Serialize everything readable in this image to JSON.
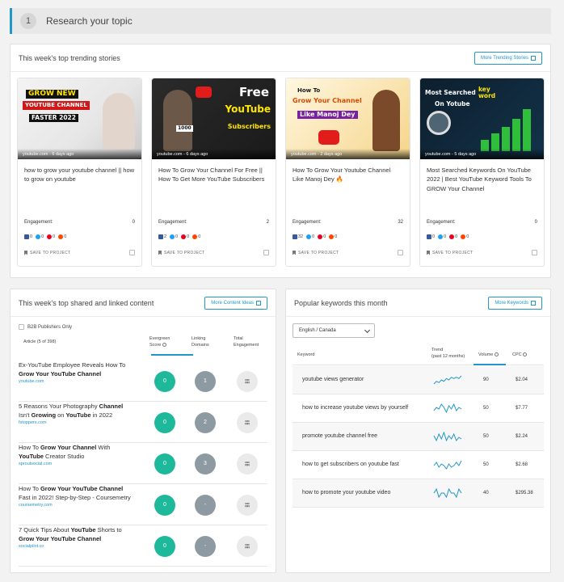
{
  "step": {
    "number": "1",
    "title": "Research your topic"
  },
  "trending": {
    "title": "This week's top trending stories",
    "more_label": "More Trending Stories",
    "engagement_label": "Engagement:",
    "save_label": "SAVE TO PROJECT",
    "cards": [
      {
        "source": "youtube.com - 6 days ago",
        "title": "how to grow your youtube channel || how to grow on youtube",
        "engagement": "0",
        "social": {
          "facebook": "0",
          "twitter": "0",
          "pinterest": "0",
          "reddit": "0"
        },
        "thumb_text": [
          "GROW NEW",
          "YOUTUBE CHANNEL",
          "FASTER 2022"
        ]
      },
      {
        "source": "youtube.com - 6 days ago",
        "title": "How To Grow Your Channel For Free || How To Get More YouTube Subscribers",
        "engagement": "2",
        "social": {
          "facebook": "2",
          "twitter": "0",
          "pinterest": "0",
          "reddit": "0"
        },
        "thumb_text": [
          "Free",
          "YouTube",
          "Subscribers",
          "1000"
        ]
      },
      {
        "source": "youtube.com - 2 days ago",
        "title": "How To Grow Your Youtube Channel Like Manoj Dey 🔥",
        "engagement": "32",
        "social": {
          "facebook": "32",
          "twitter": "0",
          "pinterest": "0",
          "reddit": "0"
        },
        "thumb_text": [
          "How To",
          "Grow Your Channel",
          "Like Manoj Dey"
        ]
      },
      {
        "source": "youtube.com - 5 days ago",
        "title": "Most Searched Keywords On YouTube 2022 | Best YouTube Keyword Tools To GROW Your Channel",
        "engagement": "0",
        "social": {
          "facebook": "0",
          "twitter": "0",
          "pinterest": "0",
          "reddit": "0"
        },
        "thumb_text": [
          "Most Searched",
          "key word",
          "On Yotube"
        ]
      }
    ]
  },
  "shared": {
    "title": "This week's top shared and linked content",
    "more_label": "More Content Ideas",
    "b2b_label": "B2B Publishers Only",
    "col_article": "Article (5 of 398)",
    "col_evergreen": [
      "Evergreen",
      "Score"
    ],
    "col_linking": [
      "Linking",
      "Domains"
    ],
    "col_total": [
      "Total",
      "Engagement"
    ],
    "rows": [
      {
        "parts": [
          {
            "t": "Ex-YouTube Employee Reveals How To "
          },
          {
            "t": "Grow Your YouTube Channel",
            "b": true
          }
        ],
        "source": "youtube.com",
        "evergreen": "0",
        "linking": "1",
        "total": "㗊"
      },
      {
        "parts": [
          {
            "t": "5 Reasons Your Photography "
          },
          {
            "t": "Channel",
            "b": true
          },
          {
            "t": " Isn't "
          },
          {
            "t": "Growing",
            "b": true
          },
          {
            "t": " on "
          },
          {
            "t": "YouTube",
            "b": true
          },
          {
            "t": " in 2022"
          }
        ],
        "source": "fstoppers.com",
        "evergreen": "0",
        "linking": "2",
        "total": "㗊"
      },
      {
        "parts": [
          {
            "t": "How To "
          },
          {
            "t": "Grow Your Channel",
            "b": true
          },
          {
            "t": " With "
          },
          {
            "t": "YouTube",
            "b": true
          },
          {
            "t": " Creator Studio"
          }
        ],
        "source": "sproutsocial.com",
        "evergreen": "0",
        "linking": "3",
        "total": "㗊"
      },
      {
        "parts": [
          {
            "t": "How To "
          },
          {
            "t": "Grow Your YouTube Channel",
            "b": true
          },
          {
            "t": " Fast in 2022! Step-by-Step - Coursemetry"
          }
        ],
        "source": "coursemetry.com",
        "evergreen": "0",
        "linking": "-",
        "total": "㗊"
      },
      {
        "parts": [
          {
            "t": "7 Quick Tips About "
          },
          {
            "t": "YouTube",
            "b": true
          },
          {
            "t": " Shorts to "
          },
          {
            "t": "Grow Your YouTube Channel",
            "b": true
          }
        ],
        "source": "socialpilot.co",
        "evergreen": "0",
        "linking": "-",
        "total": "㗊"
      }
    ]
  },
  "keywords": {
    "title": "Popular keywords this month",
    "more_label": "More Keywords",
    "locale": "English / Canada",
    "col_keyword": "Keyword",
    "col_trend": [
      "Trend",
      "(past 12 months)"
    ],
    "col_volume": "Volume",
    "col_cpc": "CPC",
    "rows": [
      {
        "keyword": "youtube views generator",
        "volume": "90",
        "cpc": "$2.04",
        "trend": [
          3,
          5,
          4,
          6,
          5,
          7,
          6,
          8,
          7,
          8,
          7,
          9
        ]
      },
      {
        "keyword": "how to increase youtube views by yourself",
        "volume": "50",
        "cpc": "$7.77",
        "trend": [
          4,
          6,
          5,
          8,
          6,
          3,
          7,
          5,
          8,
          4,
          6,
          5
        ]
      },
      {
        "keyword": "promote youtube channel free",
        "volume": "50",
        "cpc": "$2.24",
        "trend": [
          6,
          3,
          7,
          4,
          8,
          3,
          6,
          4,
          7,
          3,
          5,
          4
        ]
      },
      {
        "keyword": "how to get subscribers on youtube fast",
        "volume": "50",
        "cpc": "$2.68",
        "trend": [
          5,
          7,
          4,
          6,
          5,
          3,
          6,
          4,
          5,
          7,
          5,
          8
        ]
      },
      {
        "keyword": "how to promote your youtube video",
        "volume": "40",
        "cpc": "$295.38",
        "trend": [
          5,
          6,
          4,
          5,
          5,
          4,
          6,
          5,
          5,
          4,
          6,
          5
        ]
      }
    ]
  }
}
